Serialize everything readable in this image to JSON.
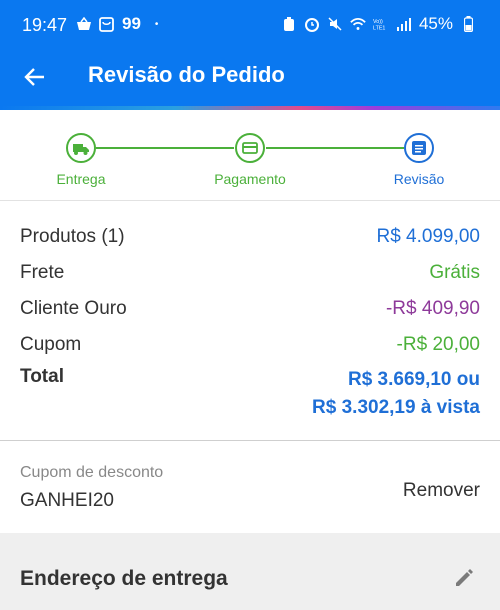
{
  "status_bar": {
    "time": "19:47",
    "app_badge": "99",
    "dot": "•",
    "battery": "45%",
    "icons": [
      "basket-icon",
      "shopping-bag-icon",
      "battery-saver-icon",
      "alarm-icon",
      "mute-icon",
      "wifi-icon",
      "volte-icon",
      "signal-icon"
    ]
  },
  "header": {
    "title": "Revisão do Pedido",
    "back_icon": "arrow-left-icon",
    "color": "#0a78f0"
  },
  "stepper": {
    "steps": [
      {
        "label": "Entrega",
        "icon": "truck-icon",
        "state": "done"
      },
      {
        "label": "Pagamento",
        "icon": "card-icon",
        "state": "done"
      },
      {
        "label": "Revisão",
        "icon": "list-icon",
        "state": "current"
      }
    ],
    "done_color": "#4bb03a",
    "current_color": "#1f6fd6"
  },
  "summary": {
    "rows": [
      {
        "label": "Produtos (1)",
        "value": "R$ 4.099,00"
      },
      {
        "label": "Frete",
        "value": "Grátis"
      },
      {
        "label": "Cliente Ouro",
        "value": "-R$ 409,90"
      },
      {
        "label": "Cupom",
        "value": "-R$ 20,00"
      }
    ],
    "total_label": "Total",
    "total_line1": "R$ 3.669,10 ou",
    "total_line2": "R$ 3.302,19 à vista"
  },
  "coupon": {
    "label": "Cupom de desconto",
    "code": "GANHEI20",
    "remove_label": "Remover"
  },
  "address": {
    "title": "Endereço de entrega",
    "edit_icon": "pencil-icon"
  }
}
